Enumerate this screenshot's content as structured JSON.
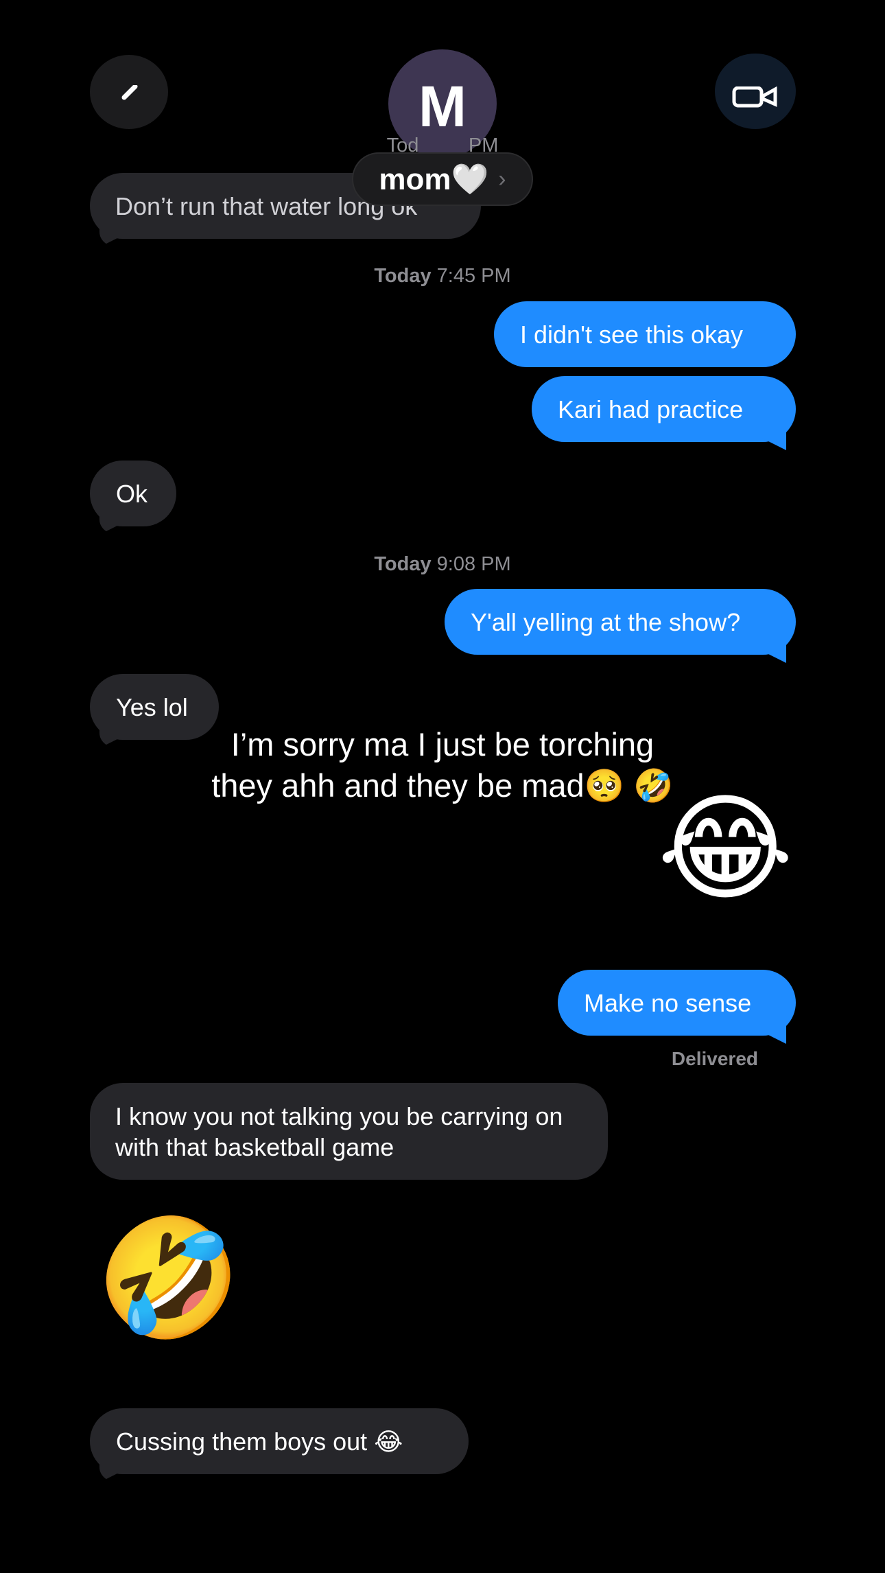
{
  "header": {
    "back_icon": "chevron-left-icon",
    "avatar_initial": "M",
    "contact_name": "mom🤍",
    "contact_chevron": "›",
    "video_icon": "video-camera-icon"
  },
  "messages": [
    {
      "id": "m1",
      "direction": "incoming",
      "text": "Don’t run that water long ok"
    },
    {
      "id": "ts1",
      "type": "timestamp",
      "day": "Today",
      "time": "7:45 PM"
    },
    {
      "id": "m2",
      "direction": "outgoing",
      "text": "I didn't see this okay"
    },
    {
      "id": "m3",
      "direction": "outgoing",
      "text": "Kari had practice"
    },
    {
      "id": "m4",
      "direction": "incoming",
      "text": "Ok"
    },
    {
      "id": "ts2",
      "type": "timestamp",
      "day": "Today",
      "time": "9:08 PM"
    },
    {
      "id": "m5",
      "direction": "outgoing",
      "text": "Y'all yelling at the show?"
    },
    {
      "id": "m6",
      "direction": "incoming",
      "text": "Yes lol"
    },
    {
      "id": "m7",
      "direction": "outgoing",
      "type": "emoji",
      "text": "😂"
    },
    {
      "id": "m8",
      "direction": "outgoing",
      "text": "Make no sense",
      "status": "Delivered"
    },
    {
      "id": "m9",
      "direction": "incoming",
      "text": "I know you not talking you be carrying on with that basketball game"
    },
    {
      "id": "m10",
      "direction": "incoming",
      "type": "emoji",
      "text": "🤣"
    },
    {
      "id": "m11",
      "direction": "incoming",
      "text": "Cussing them boys out 😂"
    }
  ],
  "overlay_caption": "I’m sorry ma I just be torching they ahh and they be mad🥺 🤣"
}
